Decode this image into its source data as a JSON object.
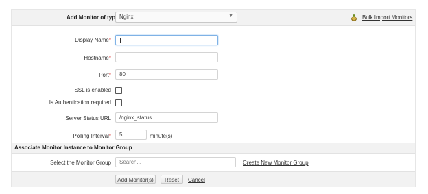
{
  "header": {
    "monitor_type_label": "Add Monitor of type",
    "monitor_type_value": "Nginx",
    "bulk_import_label": "Bulk Import Monitors"
  },
  "form": {
    "display_name": {
      "label": "Display Name",
      "required": "*",
      "value": ""
    },
    "hostname": {
      "label": "Hostname",
      "required": "*",
      "value": ""
    },
    "port": {
      "label": "Port",
      "required": "*",
      "value": "80"
    },
    "ssl": {
      "label": "SSL is enabled",
      "checked": false
    },
    "auth": {
      "label": "Is Authentication required",
      "checked": false
    },
    "status_url": {
      "label": "Server Status URL",
      "value": "/nginx_status"
    },
    "polling": {
      "label": "Polling Interval",
      "required": "*",
      "value": "5",
      "unit": "minute(s)"
    }
  },
  "group_section": {
    "title": "Associate Monitor Instance to Monitor Group",
    "select_label": "Select the Monitor Group",
    "search_placeholder": "Search...",
    "create_link": "Create New Monitor Group"
  },
  "footer": {
    "add_button": "Add Monitor(s)",
    "reset_button": "Reset",
    "cancel_link": "Cancel"
  },
  "colors": {
    "required": "#d9322f",
    "focus_border": "#7fb2e6",
    "bar_bg": "#f2f2f2"
  }
}
